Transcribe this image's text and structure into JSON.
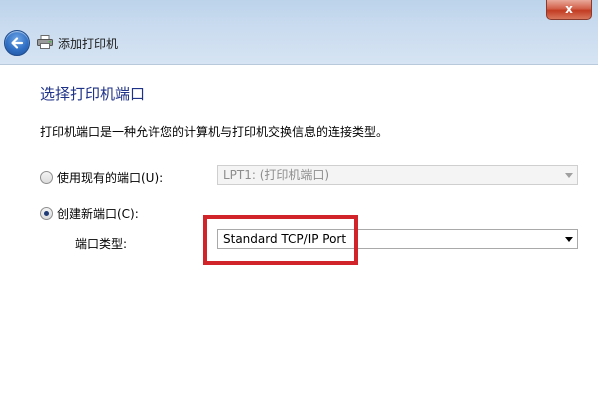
{
  "window": {
    "title": "添加打印机",
    "close_label": "x"
  },
  "page": {
    "heading": "选择打印机端口",
    "description": "打印机端口是一种允许您的计算机与打印机交换信息的连接类型。"
  },
  "existing_port": {
    "label": "使用现有的端口(U):",
    "selected": false,
    "value": "LPT1: (打印机端口)"
  },
  "new_port": {
    "label": "创建新端口(C):",
    "selected": true,
    "type_label": "端口类型:",
    "value": "Standard TCP/IP Port"
  },
  "colors": {
    "heading": "#1e3287",
    "highlight": "#d0242a"
  }
}
